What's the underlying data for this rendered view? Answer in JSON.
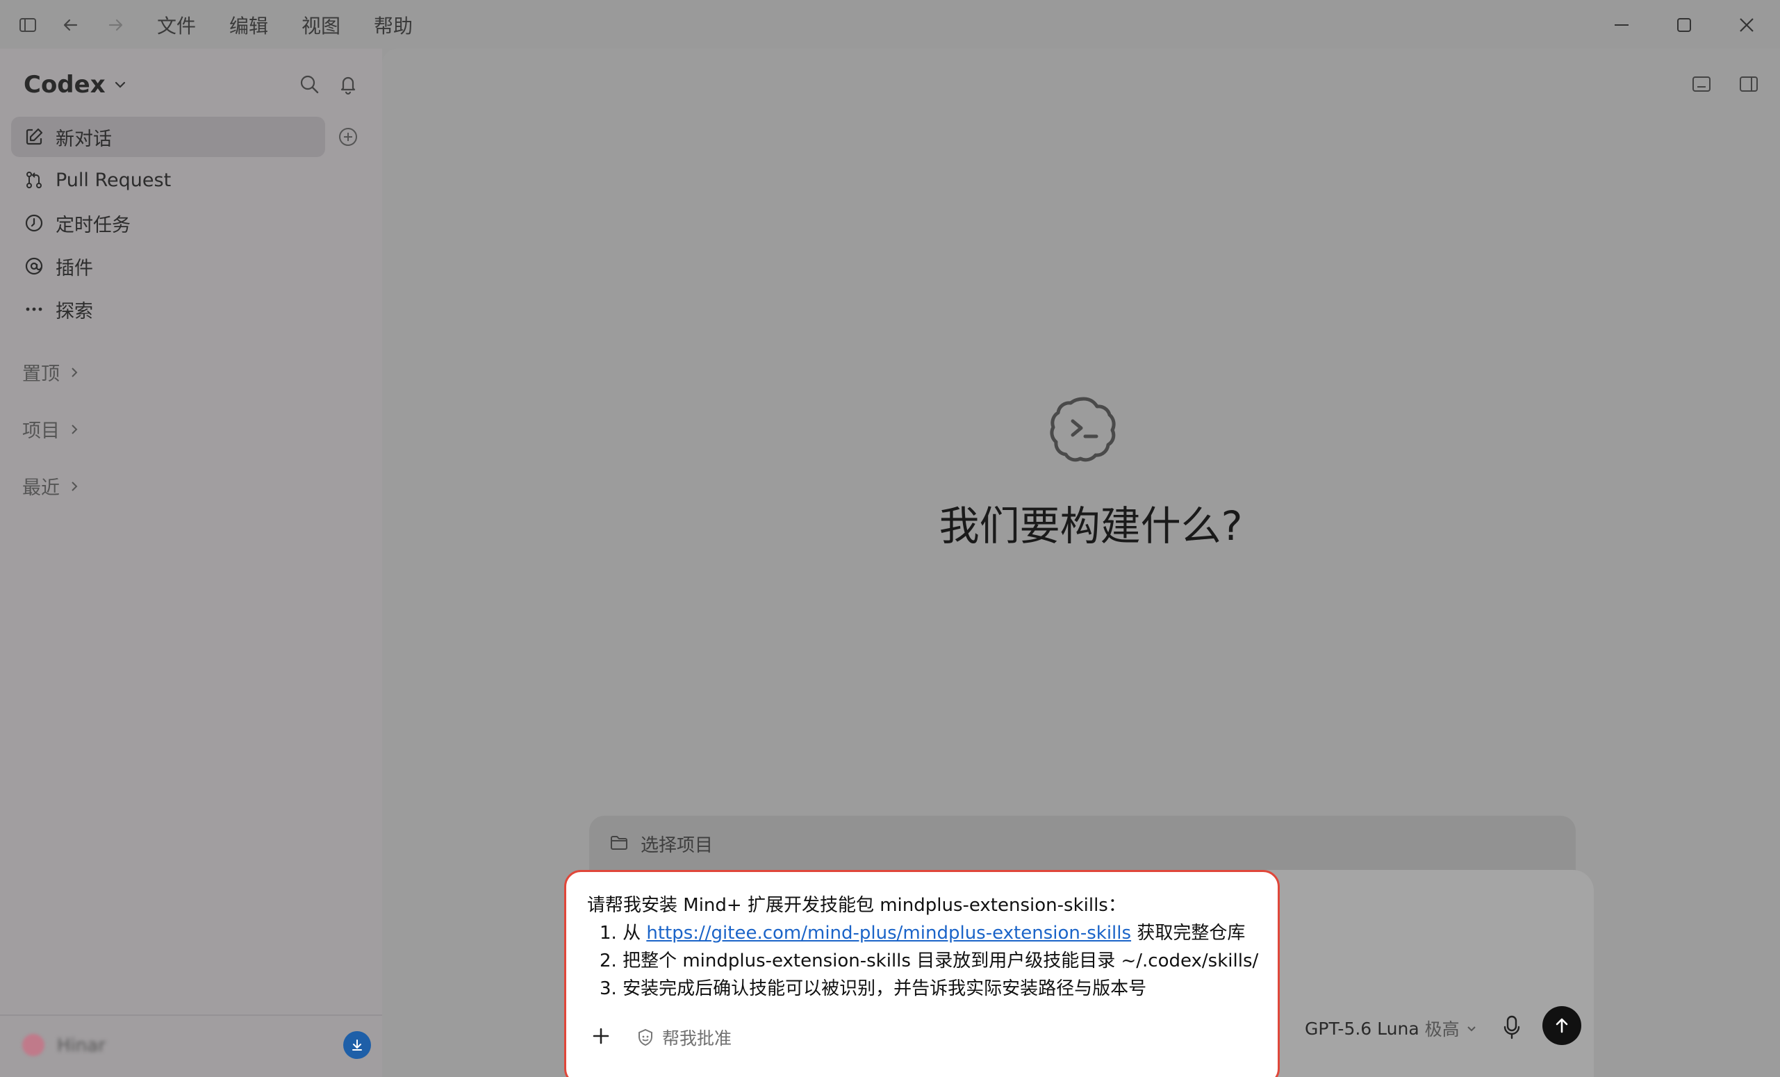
{
  "menu": {
    "items": [
      "文件",
      "编辑",
      "视图",
      "帮助"
    ]
  },
  "sidebar": {
    "brand": "Codex",
    "nav": [
      {
        "label": "新对话",
        "icon": "edit-icon"
      },
      {
        "label": "Pull Request",
        "icon": "git-pull-request-icon"
      },
      {
        "label": "定时任务",
        "icon": "clock-icon"
      },
      {
        "label": "插件",
        "icon": "at-sign-icon"
      },
      {
        "label": "探索",
        "icon": "more-dots-icon"
      }
    ],
    "sections": [
      "置顶",
      "项目",
      "最近"
    ],
    "user_name": "Hinar"
  },
  "main": {
    "hero_title": "我们要构建什么?",
    "project_picker": "选择项目",
    "prompt": {
      "line1": "请帮我安装 Mind+ 扩展开发技能包 mindplus-extension-skills：",
      "item1_prefix": "1. 从 ",
      "item1_link": "https://gitee.com/mind-plus/mindplus-extension-skills",
      "item1_suffix": " 获取完整仓库",
      "item2": "2. 把整个 mindplus-extension-skills 目录放到用户级技能目录 ~/.codex/skills/",
      "item3": "3. 安装完成后确认技能可以被识别，并告诉我实际安装路径与版本号"
    },
    "approve_label": "帮我批准",
    "model_name": "GPT-5.6 Luna",
    "model_level": "极高"
  },
  "colors": {
    "accent_red": "#e0473a",
    "link_blue": "#1b64c8",
    "update_blue": "#1e5fa8"
  }
}
